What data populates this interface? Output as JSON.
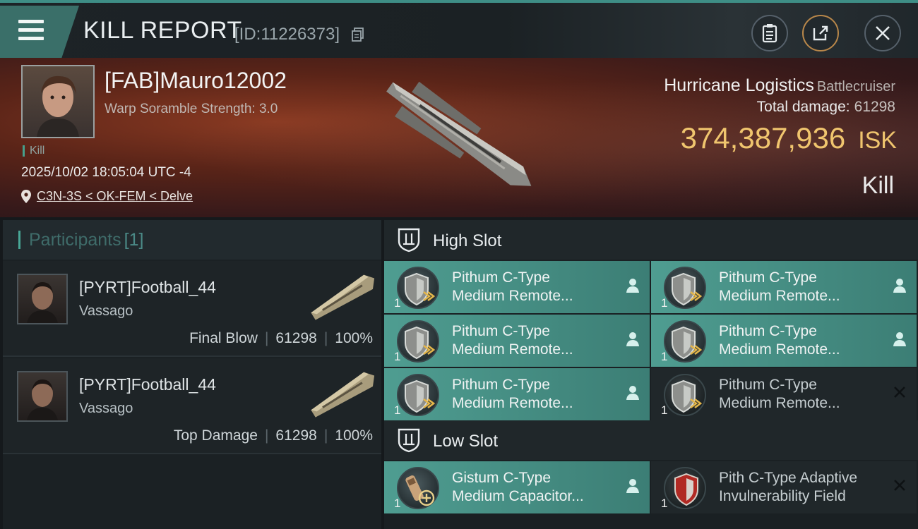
{
  "header": {
    "title": "KILL REPORT",
    "report_id": "[ID:11226373]"
  },
  "victim": {
    "pilot_name": "[FAB]Mauro12002",
    "warp_scramble": "Warp Soramble Strength: 3.0",
    "tag": "Kill",
    "datetime": "2025/10/02 18:05:04 UTC -4",
    "location": "C3N-3S < OK-FEM < Delve",
    "ship_name": "Hurricane Logistics",
    "ship_class": "Battlecruiser",
    "total_damage_label": "Total damage:",
    "total_damage": "61298",
    "isk_value": "374,387,936",
    "isk_unit": "ISK",
    "result": "Kill"
  },
  "participants": {
    "label": "Participants",
    "count": "[1]",
    "rows": [
      {
        "name": "[PYRT]Football_44",
        "ship": "Vassago",
        "role": "Final Blow",
        "damage": "61298",
        "percent": "100%"
      },
      {
        "name": "[PYRT]Football_44",
        "ship": "Vassago",
        "role": "Top Damage",
        "damage": "61298",
        "percent": "100%"
      }
    ]
  },
  "slots": {
    "high_label": "High Slot",
    "low_label": "Low Slot",
    "high": [
      {
        "qty": "1",
        "line1": "Pithum C-Type",
        "line2": "Medium Remote...",
        "state": "on"
      },
      {
        "qty": "1",
        "line1": "Pithum C-Type",
        "line2": "Medium Remote...",
        "state": "on"
      },
      {
        "qty": "1",
        "line1": "Pithum C-Type",
        "line2": "Medium Remote...",
        "state": "on"
      },
      {
        "qty": "1",
        "line1": "Pithum C-Type",
        "line2": "Medium Remote...",
        "state": "on"
      },
      {
        "qty": "1",
        "line1": "Pithum C-Type",
        "line2": "Medium Remote...",
        "state": "on"
      },
      {
        "qty": "1",
        "line1": "Pithum C-Type",
        "line2": "Medium Remote...",
        "state": "off"
      }
    ],
    "low": [
      {
        "qty": "1",
        "line1": "Gistum C-Type",
        "line2": "Medium Capacitor...",
        "state": "on"
      },
      {
        "qty": "1",
        "line1": "Pith C-Type Adaptive",
        "line2": "Invulnerability Field",
        "state": "off"
      }
    ]
  },
  "colors": {
    "accent": "#4f9d91",
    "isk": "#f0c56e",
    "hero": "#5a2418"
  }
}
